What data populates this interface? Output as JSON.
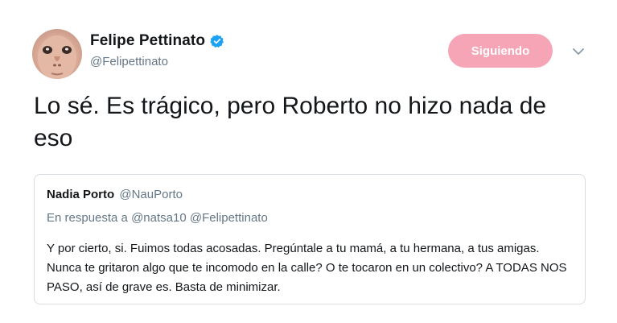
{
  "author": {
    "display_name": "Felipe Pettinato",
    "username": "@Felipettinato",
    "verified": true,
    "avatar_icon": "profile-photo"
  },
  "follow_button": {
    "label": "Siguiendo",
    "color": "#f6a5b7"
  },
  "more_menu_icon": "chevron-down-icon",
  "tweet": {
    "text": "Lo sé. Es trágico, pero Roberto no hizo nada de eso"
  },
  "quoted_tweet": {
    "display_name": "Nadia Porto",
    "username": "@NauPorto",
    "reply_prefix": "En respuesta a",
    "reply_mentions": "@natsa10 @Felipettinato",
    "text": "Y por cierto, si. Fuimos todas acosadas. Pregúntale a tu mamá, a tu hermana, a tus amigas. Nunca te gritaron algo que te incomodo en la calle? O te tocaron en un colectivo? A TODAS NOS PASO, así de grave es. Basta de minimizar."
  },
  "colors": {
    "verified_blue": "#1da1f2",
    "secondary_text": "#657786",
    "border": "#d8dde2"
  }
}
